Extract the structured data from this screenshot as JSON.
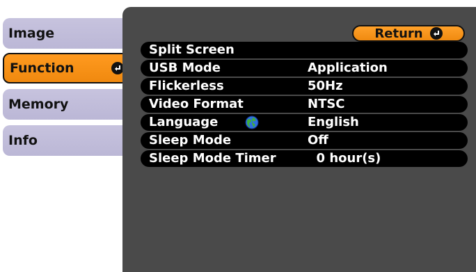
{
  "sidebar": {
    "tabs": [
      {
        "label": "Image"
      },
      {
        "label": "Function"
      },
      {
        "label": "Memory"
      },
      {
        "label": "Info"
      }
    ]
  },
  "panel": {
    "return_label": "Return",
    "rows": [
      {
        "label": "Split Screen",
        "value": ""
      },
      {
        "label": "USB Mode",
        "value": "Application"
      },
      {
        "label": "Flickerless",
        "value": "50Hz"
      },
      {
        "label": "Video Format",
        "value": "NTSC"
      },
      {
        "label": "Language",
        "value": "English"
      },
      {
        "label": "Sleep Mode",
        "value": "Off"
      },
      {
        "label": "Sleep Mode Timer",
        "value": "  0 hour(s)"
      }
    ]
  },
  "colors": {
    "accent": "#f5901a",
    "tab_inactive": "#c0bcd9",
    "panel_bg": "#4a4a4a",
    "row_bg": "#000000"
  },
  "icons": {
    "enter": "enter-icon",
    "language": "globe-icon"
  }
}
